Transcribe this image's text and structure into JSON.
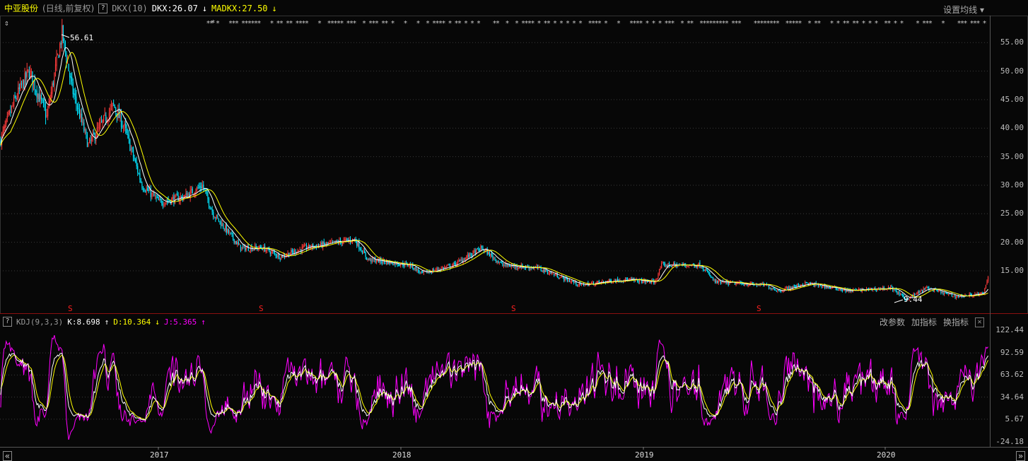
{
  "header": {
    "stock_name": "中亚股份",
    "mode": "(日线,前复权)",
    "help": "?",
    "indicator": "DKX(10)",
    "dkx": "DKX:26.07",
    "dkx_arrow": "↓",
    "madkx": "MADKX:27.50",
    "madkx_arrow": "↓",
    "ma_settings": "设置均线 ▾"
  },
  "sub": {
    "help": "?",
    "indicator": "KDJ(9,3,3)",
    "k": "K:8.698",
    "k_arrow": "↑",
    "d": "D:10.364",
    "d_arrow": "↓",
    "j": "J:5.365",
    "j_arrow": "↑",
    "change_params": "改参数",
    "add_indicator": "加指标",
    "switch_indicator": "换指标",
    "close": "✕"
  },
  "price_axis": [
    "55.00",
    "50.00",
    "45.00",
    "40.00",
    "35.00",
    "30.00",
    "25.00",
    "20.00",
    "15.00"
  ],
  "kdj_axis": [
    "122.44",
    "92.59",
    "63.62",
    "34.64",
    "5.67",
    "-24.18"
  ],
  "years": [
    "2017",
    "2018",
    "2019",
    "2020"
  ],
  "annotations": {
    "high": "56.61",
    "low": "9.44",
    "signal": "S"
  },
  "nav": {
    "left": "«",
    "right": "»"
  },
  "colors": {
    "up": "#ff3b3b",
    "down": "#00e5ff",
    "dkx": "#ffffff",
    "madkx": "#ffff00",
    "j": "#ff00ff"
  },
  "chart_data": {
    "type": "candlestick",
    "title": "中亚股份 日线 前复权",
    "ylim": [
      9.44,
      56.61
    ],
    "kdj_ylim": [
      -24.18,
      122.44
    ],
    "x_ticks": [
      "2017",
      "2018",
      "2019",
      "2020"
    ],
    "price_path_bar_price": [
      [
        0,
        38
      ],
      [
        13,
        45
      ],
      [
        26,
        50
      ],
      [
        42,
        42
      ],
      [
        56,
        56.61
      ],
      [
        65,
        47
      ],
      [
        80,
        37
      ],
      [
        103,
        44
      ],
      [
        113,
        40
      ],
      [
        129,
        30
      ],
      [
        145,
        27
      ],
      [
        168,
        28
      ],
      [
        184,
        30
      ],
      [
        194,
        25
      ],
      [
        219,
        19
      ],
      [
        239,
        19
      ],
      [
        255,
        17.5
      ],
      [
        277,
        19
      ],
      [
        323,
        20.5
      ],
      [
        335,
        17
      ],
      [
        374,
        16
      ],
      [
        384,
        14.5
      ],
      [
        413,
        16
      ],
      [
        439,
        19
      ],
      [
        458,
        16
      ],
      [
        490,
        15.5
      ],
      [
        529,
        12.5
      ],
      [
        568,
        13.5
      ],
      [
        597,
        13
      ],
      [
        603,
        16
      ],
      [
        639,
        16
      ],
      [
        652,
        13
      ],
      [
        697,
        12.5
      ],
      [
        710,
        11.5
      ],
      [
        735,
        12.8
      ],
      [
        774,
        11.5
      ],
      [
        813,
        12
      ],
      [
        826,
        10
      ],
      [
        845,
        12
      ],
      [
        871,
        10.5
      ],
      [
        897,
        11
      ],
      [
        901,
        14
      ]
    ],
    "last": {
      "dkx": 26.07,
      "madkx": 27.5,
      "k": 8.698,
      "d": 10.364,
      "j": 5.365
    }
  }
}
